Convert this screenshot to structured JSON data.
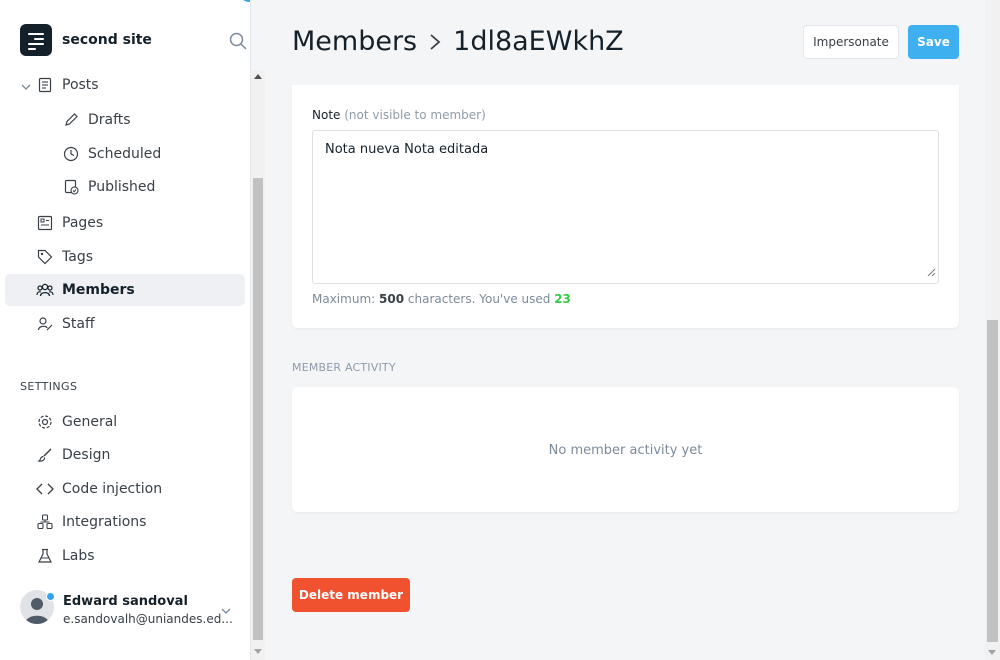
{
  "brand": {
    "name": "second site",
    "logo_icon": "ghost-logo-icon",
    "search_icon": "search-icon"
  },
  "nav": {
    "posts": {
      "label": "Posts",
      "icon": "posts-icon",
      "expanded": true
    },
    "drafts": {
      "label": "Drafts",
      "icon": "pencil-icon"
    },
    "scheduled": {
      "label": "Scheduled",
      "icon": "clock-icon"
    },
    "published": {
      "label": "Published",
      "icon": "published-icon"
    },
    "pages": {
      "label": "Pages",
      "icon": "pages-icon"
    },
    "tags": {
      "label": "Tags",
      "icon": "tag-icon"
    },
    "members": {
      "label": "Members",
      "icon": "members-icon",
      "active": true
    },
    "staff": {
      "label": "Staff",
      "icon": "staff-icon"
    }
  },
  "settings": {
    "label": "SETTINGS",
    "general": {
      "label": "General",
      "icon": "gear-icon"
    },
    "design": {
      "label": "Design",
      "icon": "brush-icon"
    },
    "code_injection": {
      "label": "Code injection",
      "icon": "code-icon"
    },
    "integrations": {
      "label": "Integrations",
      "icon": "integrations-icon"
    },
    "labs": {
      "label": "Labs",
      "icon": "flask-icon"
    }
  },
  "user": {
    "name": "Edward sandoval",
    "email": "e.sandovalh@uniandes.ed...",
    "status_color": "#2fa3ec"
  },
  "header": {
    "section": "Members",
    "member_id": "1dl8aEWkhZ"
  },
  "actions": {
    "impersonate": "Impersonate",
    "save": "Save",
    "delete": "Delete member"
  },
  "note": {
    "label": "Note",
    "hint": "(not visible to member)",
    "value": "Nota nueva Nota editada",
    "count_prefix": "Maximum:",
    "max": "500",
    "count_middle": "characters. You've used",
    "used": "23"
  },
  "activity": {
    "label": "MEMBER ACTIVITY",
    "empty": "No member activity yet"
  },
  "colors": {
    "accent": "#3eb0ef",
    "danger": "#f05230",
    "success": "#30cf43"
  }
}
